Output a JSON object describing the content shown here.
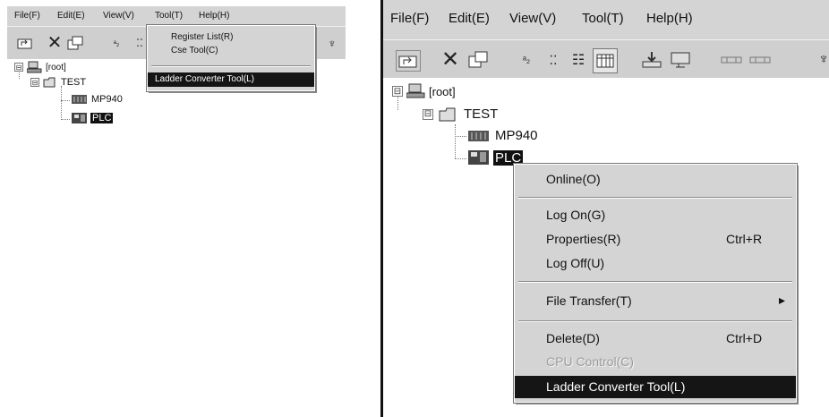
{
  "menubar": [
    "File(F)",
    "Edit(E)",
    "View(V)",
    "Tool(T)",
    "Help(H)"
  ],
  "tree": {
    "root": "[root]",
    "folder": "TEST",
    "items": [
      "MP940",
      "PLC"
    ]
  },
  "left_tool_menu": {
    "items": [
      "Register List(R)",
      "Cse Tool(C)"
    ],
    "highlighted": "Ladder Converter Tool(L)"
  },
  "context_menu": {
    "online": "Online(O)",
    "log_on": "Log On(G)",
    "properties": "Properties(R)",
    "properties_shortcut": "Ctrl+R",
    "log_off": "Log Off(U)",
    "file_transfer": "File Transfer(T)",
    "submenu_arrow": "▸",
    "delete": "Delete(D)",
    "delete_shortcut": "Ctrl+D",
    "cpu_control": "CPU Control(C)",
    "ladder_converter": "Ladder Converter Tool(L)"
  },
  "icons": {
    "expander_minus": "⊟",
    "toolbar_left": [
      "up-folder-icon",
      "delete-icon",
      "properties-icon",
      "view-icon-1",
      "view-icon-2"
    ],
    "toolbar_right": [
      "up-folder-icon",
      "delete-icon",
      "properties-icon",
      "small-icons-icon",
      "list-view-icon",
      "details-icon",
      "detail-grid-icon",
      "download-icon",
      "monitor-icon",
      "ladder-icon-1",
      "ladder-icon-2",
      "pin-icon"
    ]
  }
}
